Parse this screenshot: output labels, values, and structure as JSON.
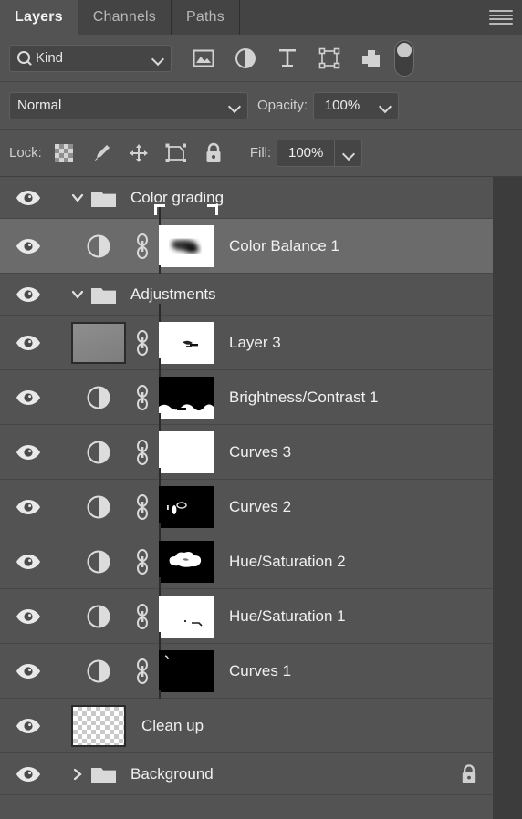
{
  "tabs": [
    {
      "label": "Layers",
      "active": true
    },
    {
      "label": "Channels",
      "active": false
    },
    {
      "label": "Paths",
      "active": false
    }
  ],
  "panel_menu": "panel-menu-icon",
  "filter": {
    "kind_label": "Kind",
    "icons": [
      "pixel-layer-filter",
      "adjustment-layer-filter",
      "type-layer-filter",
      "shape-layer-filter",
      "smart-object-filter"
    ],
    "toggle_on": false
  },
  "blend": {
    "mode": "Normal",
    "opacity_label": "Opacity:",
    "opacity_value": "100%"
  },
  "lock": {
    "label": "Lock:",
    "icons": [
      "lock-transparent-pixels",
      "lock-image-pixels",
      "lock-position",
      "lock-artboard-nesting",
      "lock-all"
    ],
    "fill_label": "Fill:",
    "fill_value": "100%"
  },
  "layers": [
    {
      "name": "Color grading",
      "type": "group",
      "expanded": true,
      "visible": true,
      "selected": false,
      "locked": false
    },
    {
      "name": "Color Balance 1",
      "type": "adjustment",
      "visible": true,
      "selected": true,
      "linked": true,
      "mask": "dark-blob-on-white",
      "mask_active": true,
      "locked": false
    },
    {
      "name": "Adjustments",
      "type": "group",
      "expanded": true,
      "visible": true,
      "selected": false,
      "locked": false
    },
    {
      "name": "Layer 3",
      "type": "pixel",
      "visible": true,
      "selected": false,
      "linked": true,
      "mask": "white-with-dark-mark",
      "mask_active": false,
      "locked": false
    },
    {
      "name": "Brightness/Contrast 1",
      "type": "adjustment",
      "visible": true,
      "selected": false,
      "linked": true,
      "mask": "black-with-white-bottom",
      "mask_active": false,
      "locked": false
    },
    {
      "name": "Curves 3",
      "type": "adjustment",
      "visible": true,
      "selected": false,
      "linked": true,
      "mask": "all-white",
      "mask_active": false,
      "locked": false
    },
    {
      "name": "Curves 2",
      "type": "adjustment",
      "visible": true,
      "selected": false,
      "linked": true,
      "mask": "black-with-white-specks",
      "mask_active": false,
      "locked": false
    },
    {
      "name": "Hue/Saturation 2",
      "type": "adjustment",
      "visible": true,
      "selected": false,
      "linked": true,
      "mask": "black-with-white-cloud",
      "mask_active": false,
      "locked": false
    },
    {
      "name": "Hue/Saturation 1",
      "type": "adjustment",
      "visible": true,
      "selected": false,
      "linked": true,
      "mask": "white-with-small-marks",
      "mask_active": false,
      "locked": false
    },
    {
      "name": "Curves 1",
      "type": "adjustment",
      "visible": true,
      "selected": false,
      "linked": true,
      "mask": "all-black-with-corner-mark",
      "mask_active": false,
      "locked": false
    },
    {
      "name": "Clean up",
      "type": "pixel-transparent",
      "visible": true,
      "selected": false,
      "linked": false,
      "locked": false
    },
    {
      "name": "Background",
      "type": "group",
      "expanded": false,
      "visible": true,
      "selected": false,
      "locked": true
    }
  ],
  "colors": {
    "panel_bg": "#535353",
    "row_selected": "#6b6b6b",
    "tab_bar": "#3c3c3c",
    "text": "#f0f0f0",
    "field_bg": "#454545"
  }
}
